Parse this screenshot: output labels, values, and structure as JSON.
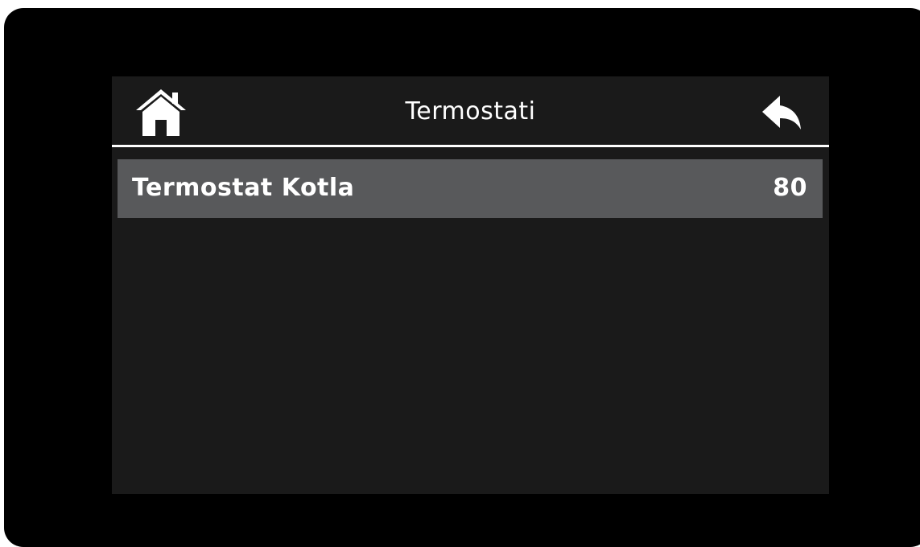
{
  "header": {
    "title": "Termostati",
    "home_icon": "home-icon",
    "back_icon": "back-arrow-icon"
  },
  "list": {
    "items": [
      {
        "label": "Termostat Kotla",
        "value": "80"
      }
    ]
  },
  "colors": {
    "bezel": "#000000",
    "screen_bg": "#1a1a1a",
    "row_bg": "#58595b",
    "text": "#ffffff"
  }
}
